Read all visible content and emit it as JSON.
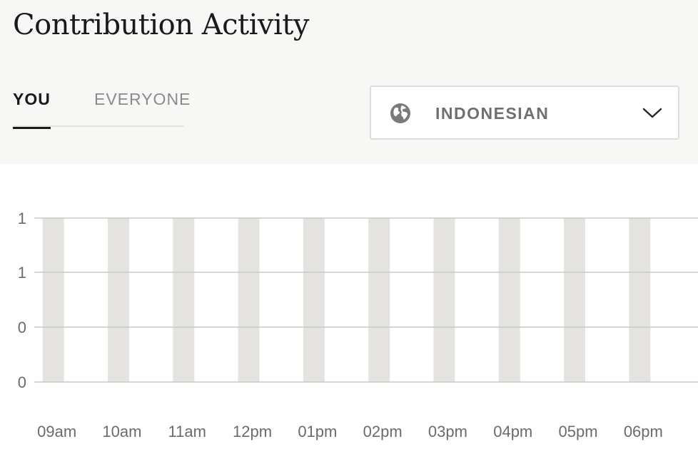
{
  "header": {
    "title": "Contribution Activity"
  },
  "tabs": [
    {
      "label": "YOU",
      "active": true
    },
    {
      "label": "EVERYONE",
      "active": false
    }
  ],
  "language_select": {
    "icon": "globe-icon",
    "selected": "INDONESIAN",
    "chevron_icon": "chevron-down-icon"
  },
  "colors": {
    "bar": "#e4e3e0",
    "gridline": "#c9c9c9",
    "axis_text": "#6b6b6b",
    "header_bg": "#f7f7f5"
  },
  "chart_data": {
    "type": "bar",
    "title": "",
    "xlabel": "",
    "ylabel": "",
    "categories": [
      "09am",
      "10am",
      "11am",
      "12pm",
      "01pm",
      "02pm",
      "03pm",
      "04pm",
      "05pm",
      "06pm"
    ],
    "values": [
      1,
      1,
      1,
      1,
      1,
      1,
      1,
      1,
      1,
      1
    ],
    "y_tick_labels": [
      "1",
      "1",
      "0",
      "0"
    ],
    "ylim": [
      0,
      1
    ],
    "grid": true,
    "legend": "none"
  }
}
